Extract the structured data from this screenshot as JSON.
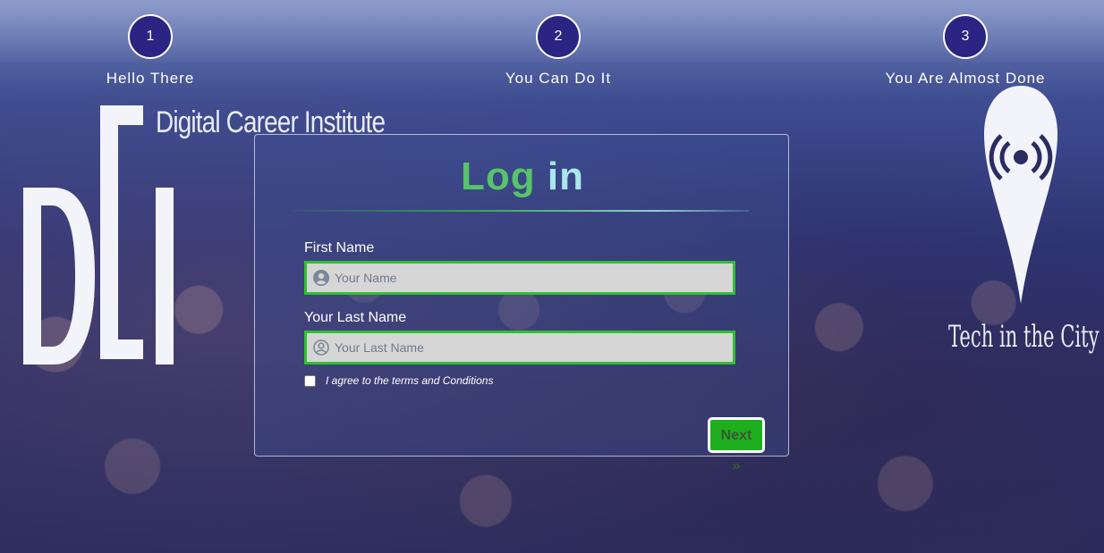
{
  "steps": [
    {
      "number": "1",
      "label": "Hello There"
    },
    {
      "number": "2",
      "label": "You Can Do It"
    },
    {
      "number": "3",
      "label": "You Are Almost Done"
    }
  ],
  "logos": {
    "dci_text": "Digital Career Institute",
    "tic_text": "Tech in the City"
  },
  "form": {
    "title_part1": "Log ",
    "title_part2": "in",
    "first_name": {
      "label": "First Name",
      "placeholder": "Your Name",
      "value": ""
    },
    "last_name": {
      "label": "Your Last Name",
      "placeholder": "Your Last Name",
      "value": ""
    },
    "terms_label": "I agree to the terms and Conditions",
    "terms_checked": false,
    "next_label": "Next »"
  },
  "colors": {
    "accent_green": "#2fc12f",
    "step_circle": "#2a2482",
    "title_green": "#58c36a"
  }
}
